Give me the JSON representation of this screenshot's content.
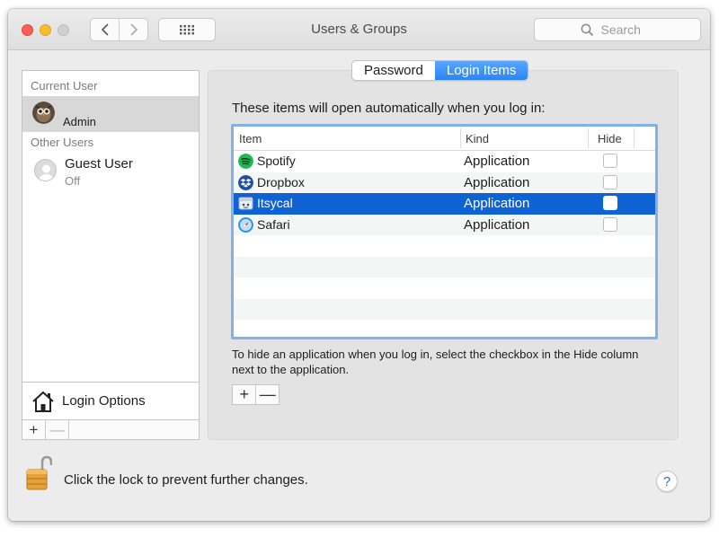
{
  "window": {
    "title": "Users & Groups",
    "search_placeholder": "Search"
  },
  "sidebar": {
    "current_user_heading": "Current User",
    "current_user": {
      "name": "Admin",
      "selected": true
    },
    "other_users_heading": "Other Users",
    "other_users": [
      {
        "name": "Guest User",
        "status": "Off"
      }
    ],
    "login_options_label": "Login Options",
    "add_label": "+",
    "remove_label": "—"
  },
  "tabs": [
    {
      "label": "Password",
      "active": false
    },
    {
      "label": "Login Items",
      "active": true
    }
  ],
  "login_items": {
    "intro": "These items will open automatically when you log in:",
    "columns": {
      "item": "Item",
      "kind": "Kind",
      "hide": "Hide"
    },
    "rows": [
      {
        "name": "Spotify",
        "kind": "Application",
        "hide": false,
        "icon": "spotify-icon",
        "color": "#1db954",
        "selected": false
      },
      {
        "name": "Dropbox",
        "kind": "Application",
        "hide": false,
        "icon": "dropbox-icon",
        "color": "#1f4fa3",
        "selected": false
      },
      {
        "name": "Itsycal",
        "kind": "Application",
        "hide": false,
        "icon": "itsycal-icon",
        "color": "#e8eef5",
        "selected": true
      },
      {
        "name": "Safari",
        "kind": "Application",
        "hide": false,
        "icon": "safari-icon",
        "color": "#2e8fe6",
        "selected": false
      }
    ],
    "help_text": "To hide an application when you log in, select the checkbox in the Hide column next to the application.",
    "add_label": "+",
    "remove_label": "—"
  },
  "footer": {
    "lock_text": "Click the lock to prevent further changes.",
    "help_label": "?"
  },
  "colors": {
    "selection": "#0f62d3",
    "tab_active": "#2b84f6",
    "close": "#fc5f57",
    "minimize": "#fdbc2e"
  }
}
